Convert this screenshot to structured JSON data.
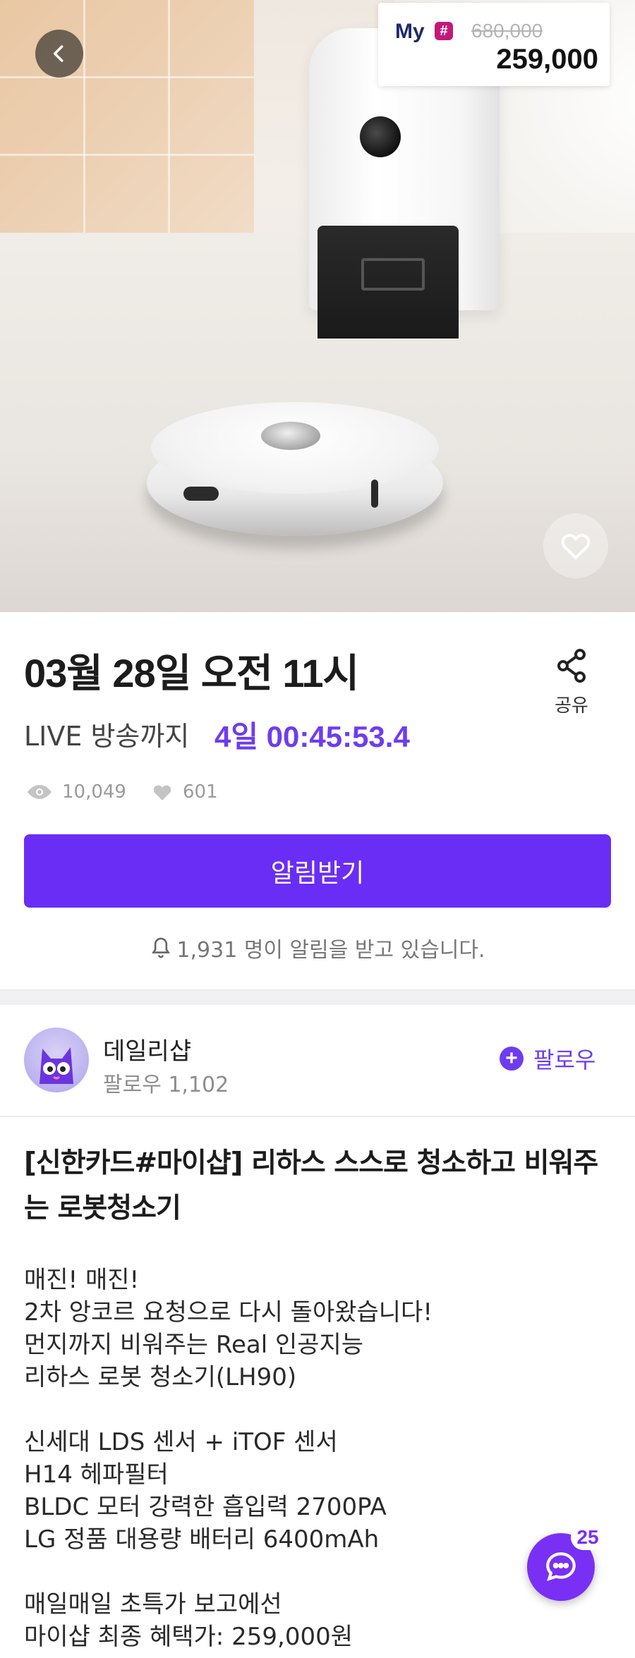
{
  "hero": {
    "promo_brand": "My",
    "promo_brand_mark": "#",
    "original_price": "680,000",
    "sale_price": "259,000",
    "back_icon": "chevron-left-icon",
    "like_icon": "heart-outline-icon"
  },
  "broadcast": {
    "date_title": "03월 28일 오전 11시",
    "countdown_label": "LIVE 방송까지",
    "countdown_value": "4일 00:45:53.4",
    "share_label": "공유",
    "views": "10,049",
    "likes": "601",
    "notify_button": "알림받기",
    "notify_count_text": "1,931 명이 알림을 받고 있습니다."
  },
  "seller": {
    "name": "데일리샵",
    "followers_text": "팔로우 1,102",
    "follow_button": "팔로우"
  },
  "product": {
    "title": "[신한카드#마이샵] 리하스 스스로 청소하고 비워주는 로봇청소기",
    "description": "매진! 매진!\n2차 앙코르 요청으로 다시 돌아왔습니다!\n먼지까지 비워주는 Real 인공지능\n리하스 로봇 청소기(LH90)\n\n신세대 LDS 센서 + iTOF 센서\nH14 헤파필터\nBLDC 모터 강력한 흡입력 2700PA\nLG 정품 대용량 배터리 6400mAh\n\n매일매일 초특가 보고에선\n마이샵 최종 혜택가: 259,000원"
  },
  "chat": {
    "badge_count": "25",
    "icon": "chat-bubble-icon"
  },
  "colors": {
    "accent": "#6a2df6",
    "countdown": "#6e3cf0",
    "brand_hash": "#c2187a",
    "brand_text": "#1d2b6a"
  }
}
